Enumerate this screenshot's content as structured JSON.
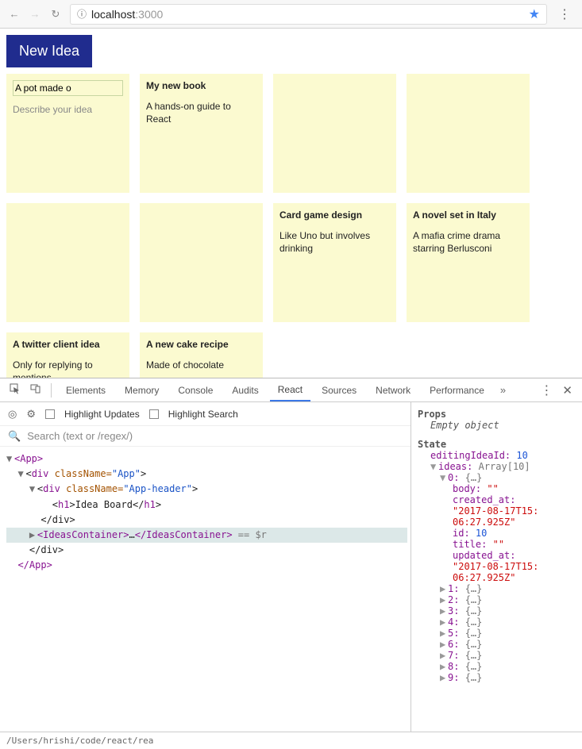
{
  "browser": {
    "url_prefix": "localhost",
    "url_suffix": ":3000",
    "info_icon": "ⓘ",
    "back": "←",
    "forward": "→",
    "reload": "↻",
    "star": "★",
    "menu": "⋮"
  },
  "app": {
    "new_idea_label": "New Idea",
    "editing_title_value": "A pot made o",
    "editing_body_placeholder": "Describe your idea",
    "tiles": [
      {
        "title": "My new book",
        "body": "A hands-on guide to React"
      },
      {
        "title": "",
        "body": ""
      },
      {
        "title": "",
        "body": ""
      },
      {
        "title": "",
        "body": ""
      },
      {
        "title": "",
        "body": ""
      },
      {
        "title": "Card game design",
        "body": "Like Uno but involves drinking"
      },
      {
        "title": "A novel set in Italy",
        "body": "A mafia crime drama starring Berlusconi"
      },
      {
        "title": "A twitter client idea",
        "body": "Only for replying to mentions"
      },
      {
        "title": "A new cake recipe",
        "body": "Made of chocolate"
      }
    ]
  },
  "devtools": {
    "tabs": [
      "Elements",
      "Memory",
      "Console",
      "Audits",
      "React",
      "Sources",
      "Network",
      "Performance"
    ],
    "active_tab": "React",
    "chev": "»",
    "menu": "⋮",
    "close": "✕",
    "toolbar": {
      "target": "◎",
      "gear": "⚙",
      "highlight_updates": "Highlight Updates",
      "highlight_search": "Highlight Search"
    },
    "search_placeholder": "Search (text or /regex/)",
    "tree": {
      "app_open": "<App>",
      "div_app": "div",
      "class_app": "className=",
      "val_app": "\"App\"",
      "div_header": "div",
      "val_header": "\"App-header\"",
      "h1": "h1",
      "h1_text": "Idea Board",
      "ideas_open": "<IdeasContainer>",
      "ideas_ellipsis": "…",
      "ideas_close": "</IdeasContainer>",
      "r_sym": " == $r",
      "div_close": "</div>",
      "app_close": "</App>"
    },
    "props_label": "Props",
    "props_empty": "Empty object",
    "state_label": "State",
    "state": {
      "editingIdeaId_key": "editingIdeaId:",
      "editingIdeaId_val": "10",
      "ideas_key": "ideas:",
      "ideas_val": "Array[10]",
      "item0": {
        "idx": "0:",
        "brace": "{…}",
        "body_key": "body:",
        "body_val": "\"\"",
        "created_key": "created_at:",
        "created_val": "\"2017-08-17T15:06:27.925Z\"",
        "id_key": "id:",
        "id_val": "10",
        "title_key": "title:",
        "title_val": "\"\"",
        "updated_key": "updated_at:",
        "updated_val": "\"2017-08-17T15:06:27.925Z\""
      },
      "rest": [
        {
          "idx": "1:",
          "brace": "{…}"
        },
        {
          "idx": "2:",
          "brace": "{…}"
        },
        {
          "idx": "3:",
          "brace": "{…}"
        },
        {
          "idx": "4:",
          "brace": "{…}"
        },
        {
          "idx": "5:",
          "brace": "{…}"
        },
        {
          "idx": "6:",
          "brace": "{…}"
        },
        {
          "idx": "7:",
          "brace": "{…}"
        },
        {
          "idx": "8:",
          "brace": "{…}"
        },
        {
          "idx": "9:",
          "brace": "{…}"
        }
      ]
    },
    "path": "/Users/hrishi/code/react/rea"
  }
}
